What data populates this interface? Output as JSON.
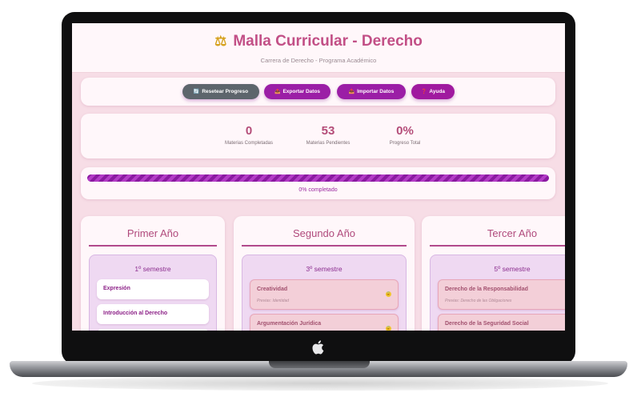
{
  "header": {
    "icon": "scales-icon",
    "title": "Malla Curricular - Derecho",
    "subtitle": "Carrera de Derecho - Programa Académico"
  },
  "toolbar": {
    "buttons": [
      {
        "label": "Resetear Progreso",
        "icon": "refresh-icon"
      },
      {
        "label": "Exportar Datos",
        "icon": "export-icon"
      },
      {
        "label": "Importar Datos",
        "icon": "import-icon"
      },
      {
        "label": "Ayuda",
        "icon": "help-icon"
      }
    ]
  },
  "stats": [
    {
      "value": "0",
      "label": "Materias Completadas"
    },
    {
      "value": "53",
      "label": "Materias Pendientes"
    },
    {
      "value": "0%",
      "label": "Progreso Total"
    }
  ],
  "progress": {
    "fraction": 0,
    "label": "0% completado"
  },
  "years": [
    {
      "title": "Primer Año",
      "semester": "1º semestre",
      "courses": [
        {
          "name": "Expresión",
          "state": "available"
        },
        {
          "name": "Introducción al Derecho",
          "state": "available"
        }
      ]
    },
    {
      "title": "Segundo Año",
      "semester": "3º semestre",
      "courses": [
        {
          "name": "Creatividad",
          "prereq": "Previas: Identidad",
          "state": "locked"
        },
        {
          "name": "Argumentación Jurídica",
          "state": "locked"
        }
      ]
    },
    {
      "title": "Tercer Año",
      "semester": "5º semestre",
      "courses": [
        {
          "name": "Derecho de la Responsabilidad",
          "prereq": "Previas: Derecho de las Obligaciones",
          "state": "locked"
        },
        {
          "name": "Derecho de la Seguridad Social",
          "state": "locked"
        }
      ]
    }
  ],
  "colors": {
    "accent": "#c24f86",
    "button": "#9b1ea6",
    "reset_button": "#5d656c",
    "progress": "#8a1aa0"
  }
}
